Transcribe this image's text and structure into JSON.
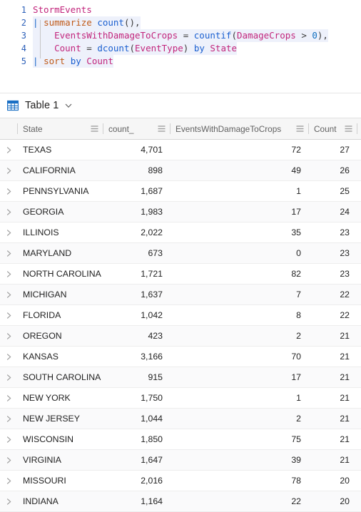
{
  "editor": {
    "name": "kql-query-editor",
    "lines": [
      {
        "n": "1",
        "indent": 0,
        "highlight": false,
        "tokens": [
          {
            "t": "StormEvents",
            "c": "tbl"
          }
        ]
      },
      {
        "n": "2",
        "indent": 0,
        "highlight": true,
        "tokens": [
          {
            "t": "|",
            "c": "pipe"
          },
          {
            "t": " ",
            "c": "op"
          },
          {
            "t": "summarize",
            "c": "kw"
          },
          {
            "t": " ",
            "c": "op"
          },
          {
            "t": "count",
            "c": "fn"
          },
          {
            "t": "(),",
            "c": "op"
          }
        ]
      },
      {
        "n": "3",
        "indent": 1,
        "highlight": true,
        "tokens": [
          {
            "t": "    ",
            "c": "op"
          },
          {
            "t": "EventsWithDamageToCrops",
            "c": "col"
          },
          {
            "t": " = ",
            "c": "op"
          },
          {
            "t": "countif",
            "c": "fn"
          },
          {
            "t": "(",
            "c": "op"
          },
          {
            "t": "DamageCrops",
            "c": "col"
          },
          {
            "t": " > ",
            "c": "op"
          },
          {
            "t": "0",
            "c": "num"
          },
          {
            "t": "),",
            "c": "op"
          }
        ]
      },
      {
        "n": "4",
        "indent": 1,
        "highlight": true,
        "tokens": [
          {
            "t": "    ",
            "c": "op"
          },
          {
            "t": "Count",
            "c": "col"
          },
          {
            "t": " = ",
            "c": "op"
          },
          {
            "t": "dcount",
            "c": "fn"
          },
          {
            "t": "(",
            "c": "op"
          },
          {
            "t": "EventType",
            "c": "col"
          },
          {
            "t": ") ",
            "c": "op"
          },
          {
            "t": "by",
            "c": "fn"
          },
          {
            "t": " ",
            "c": "op"
          },
          {
            "t": "State",
            "c": "col"
          }
        ]
      },
      {
        "n": "5",
        "indent": 0,
        "highlight": true,
        "tokens": [
          {
            "t": "|",
            "c": "pipe"
          },
          {
            "t": " ",
            "c": "op"
          },
          {
            "t": "sort",
            "c": "kw"
          },
          {
            "t": " ",
            "c": "op"
          },
          {
            "t": "by",
            "c": "fn"
          },
          {
            "t": " ",
            "c": "op"
          },
          {
            "t": "Count",
            "c": "col"
          }
        ]
      }
    ]
  },
  "result_bar": {
    "icon": "table-grid-icon",
    "title": "Table 1",
    "chevron": "chevron-down-icon"
  },
  "grid": {
    "columns": [
      {
        "key": "state",
        "label": "State",
        "align": "left"
      },
      {
        "key": "count_",
        "label": "count_",
        "align": "right"
      },
      {
        "key": "events",
        "label": "EventsWithDamageToCrops",
        "align": "right"
      },
      {
        "key": "count",
        "label": "Count",
        "align": "right"
      }
    ],
    "column_menu_icon": "column-menu-icon",
    "row_expand_icon": "chevron-right-icon",
    "rows": [
      {
        "state": "TEXAS",
        "count_": "4,701",
        "events": "72",
        "count": "27"
      },
      {
        "state": "CALIFORNIA",
        "count_": "898",
        "events": "49",
        "count": "26"
      },
      {
        "state": "PENNSYLVANIA",
        "count_": "1,687",
        "events": "1",
        "count": "25"
      },
      {
        "state": "GEORGIA",
        "count_": "1,983",
        "events": "17",
        "count": "24"
      },
      {
        "state": "ILLINOIS",
        "count_": "2,022",
        "events": "35",
        "count": "23"
      },
      {
        "state": "MARYLAND",
        "count_": "673",
        "events": "0",
        "count": "23"
      },
      {
        "state": "NORTH CAROLINA",
        "count_": "1,721",
        "events": "82",
        "count": "23"
      },
      {
        "state": "MICHIGAN",
        "count_": "1,637",
        "events": "7",
        "count": "22"
      },
      {
        "state": "FLORIDA",
        "count_": "1,042",
        "events": "8",
        "count": "22"
      },
      {
        "state": "OREGON",
        "count_": "423",
        "events": "2",
        "count": "21"
      },
      {
        "state": "KANSAS",
        "count_": "3,166",
        "events": "70",
        "count": "21"
      },
      {
        "state": "SOUTH CAROLINA",
        "count_": "915",
        "events": "17",
        "count": "21"
      },
      {
        "state": "NEW YORK",
        "count_": "1,750",
        "events": "1",
        "count": "21"
      },
      {
        "state": "NEW JERSEY",
        "count_": "1,044",
        "events": "2",
        "count": "21"
      },
      {
        "state": "WISCONSIN",
        "count_": "1,850",
        "events": "75",
        "count": "21"
      },
      {
        "state": "VIRGINIA",
        "count_": "1,647",
        "events": "39",
        "count": "21"
      },
      {
        "state": "MISSOURI",
        "count_": "2,016",
        "events": "78",
        "count": "20"
      },
      {
        "state": "INDIANA",
        "count_": "1,164",
        "events": "22",
        "count": "20"
      }
    ]
  },
  "colors": {
    "line_number": "#2b5fb8",
    "keyword": "#c05a18",
    "function": "#1a5fd0",
    "column": "#c2257c",
    "grid_icon": "#1a6fc4",
    "header_bg": "#f6f6f6",
    "row_alt_bg": "#fafafb"
  }
}
